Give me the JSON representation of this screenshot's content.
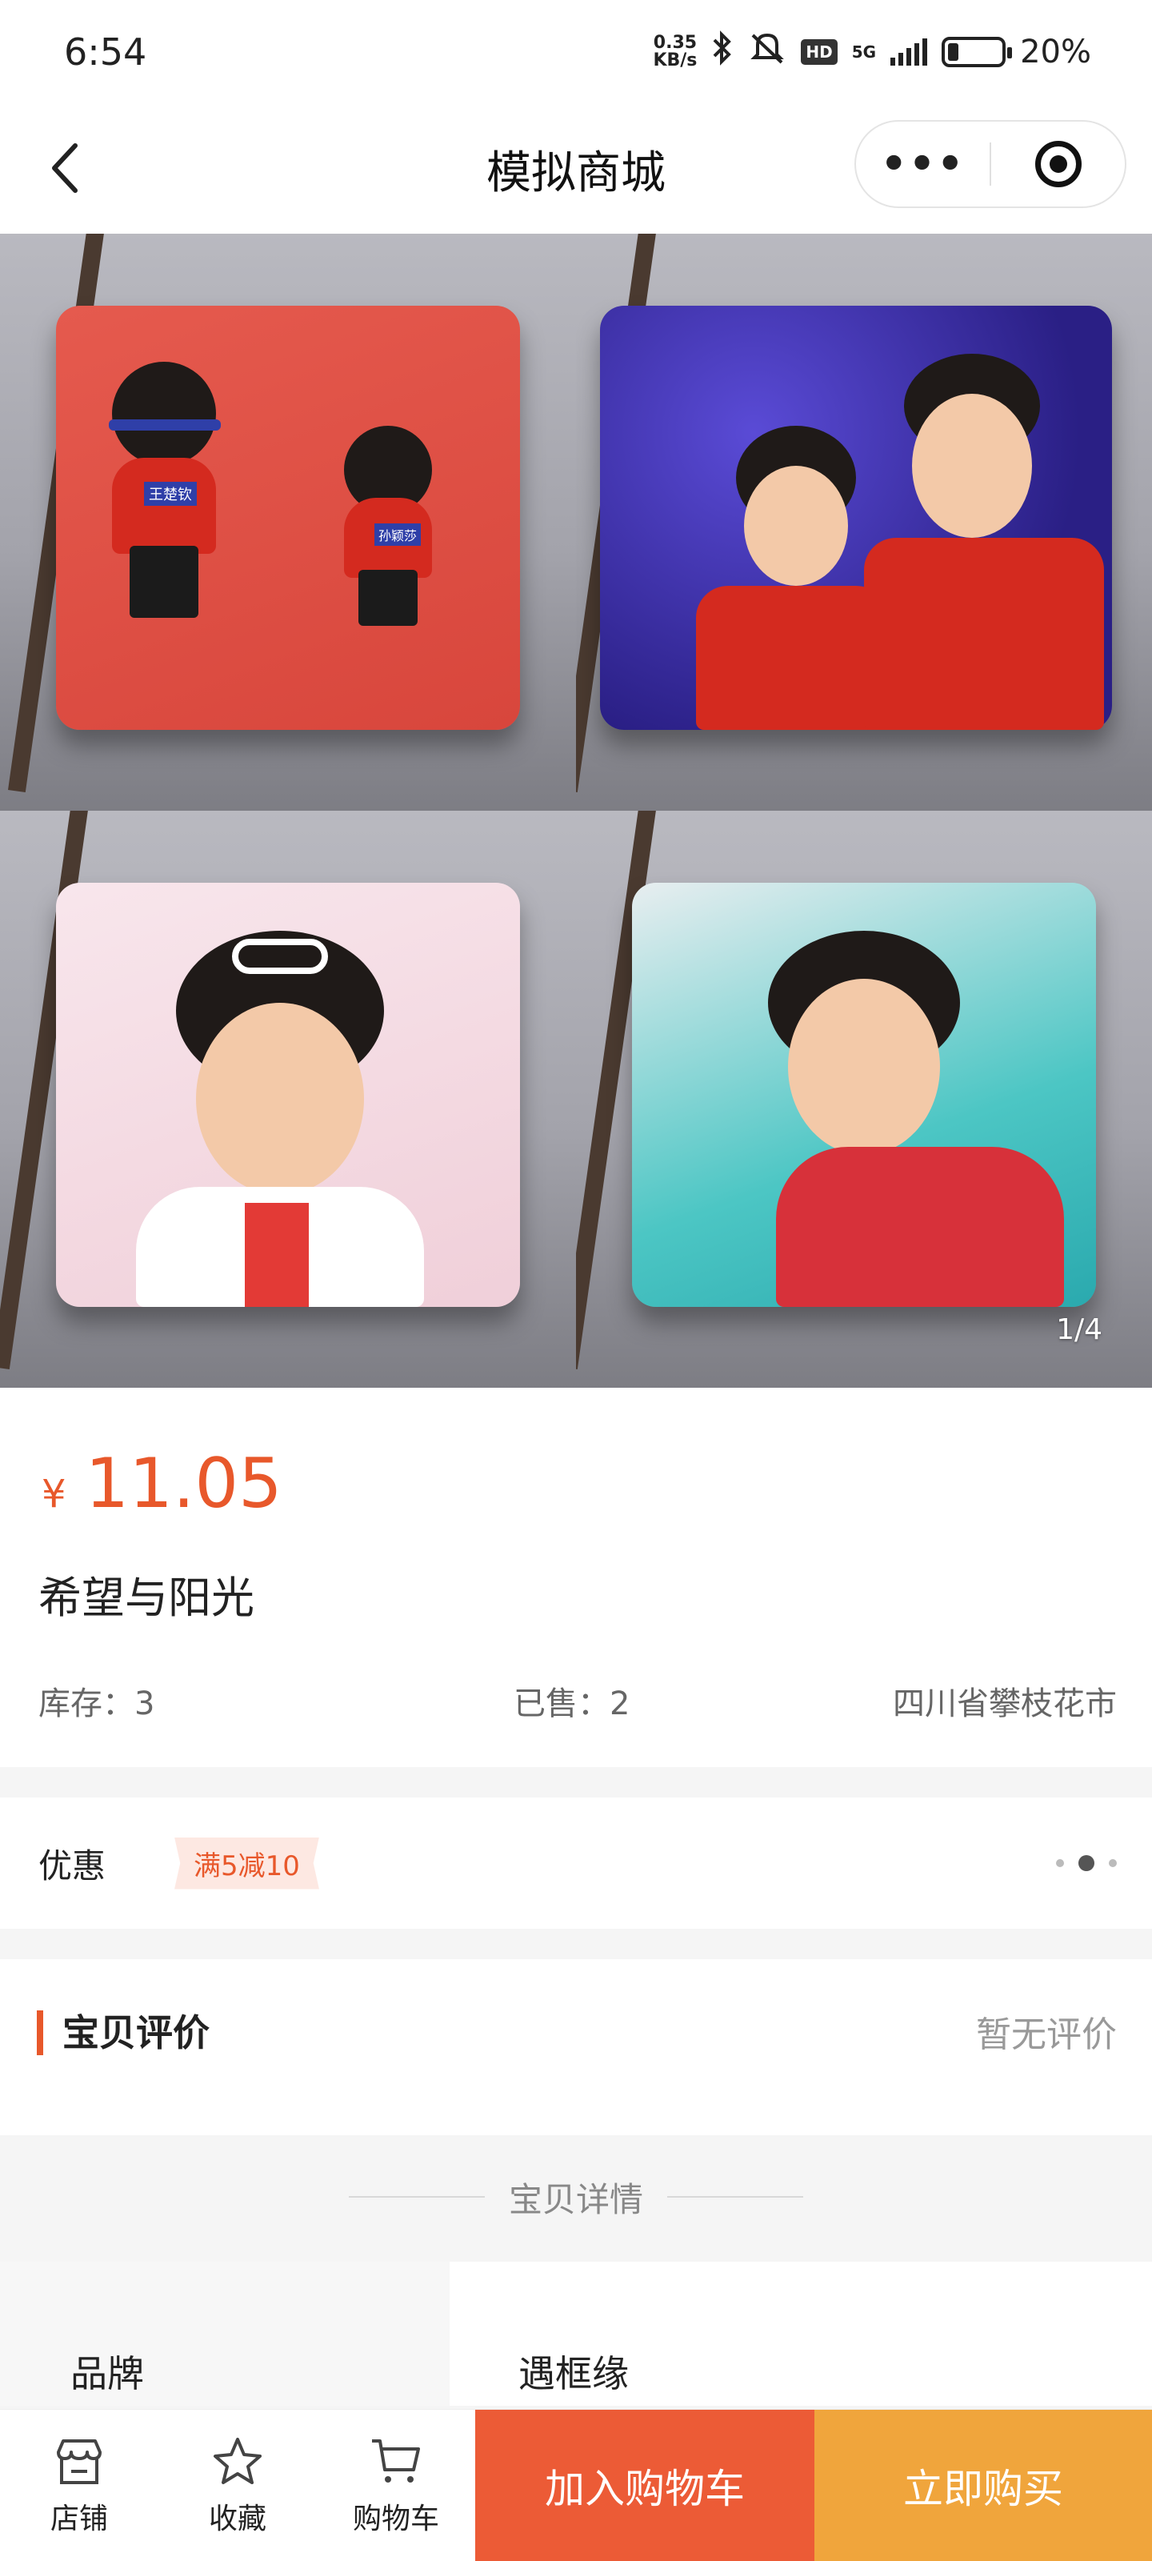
{
  "status_bar": {
    "time": "6:54",
    "net_speed_value": "0.35",
    "net_speed_unit": "KB/s",
    "hd": "HD",
    "network": "5G",
    "battery": "20%",
    "battery_level": 0.2
  },
  "nav": {
    "title": "模拟商城",
    "more": "•••"
  },
  "gallery": {
    "indicator": "1/4",
    "jersey_names": [
      "王楚钦",
      "孙颖莎"
    ],
    "total_images": 4,
    "current_image": 1
  },
  "product": {
    "currency": "¥",
    "price": "11.05",
    "title": "希望与阳光",
    "stock": "库存：3",
    "sold": "已售：2",
    "location": "四川省攀枝花市"
  },
  "promo": {
    "label": "优惠",
    "tag": "满5减10"
  },
  "reviews": {
    "title": "宝贝评价",
    "empty": "暂无评价"
  },
  "details": {
    "heading": "宝贝详情",
    "rows": [
      {
        "key": "品牌",
        "value": "遇框缘"
      }
    ]
  },
  "bottom_bar": {
    "shop": "店铺",
    "favorite": "收藏",
    "cart": "购物车",
    "add_to_cart": "加入购物车",
    "buy_now": "立即购买"
  },
  "colors": {
    "accent": "#e8582b",
    "add_to_cart_bg": "#ec5b36",
    "buy_now_bg": "#f0a53c"
  }
}
